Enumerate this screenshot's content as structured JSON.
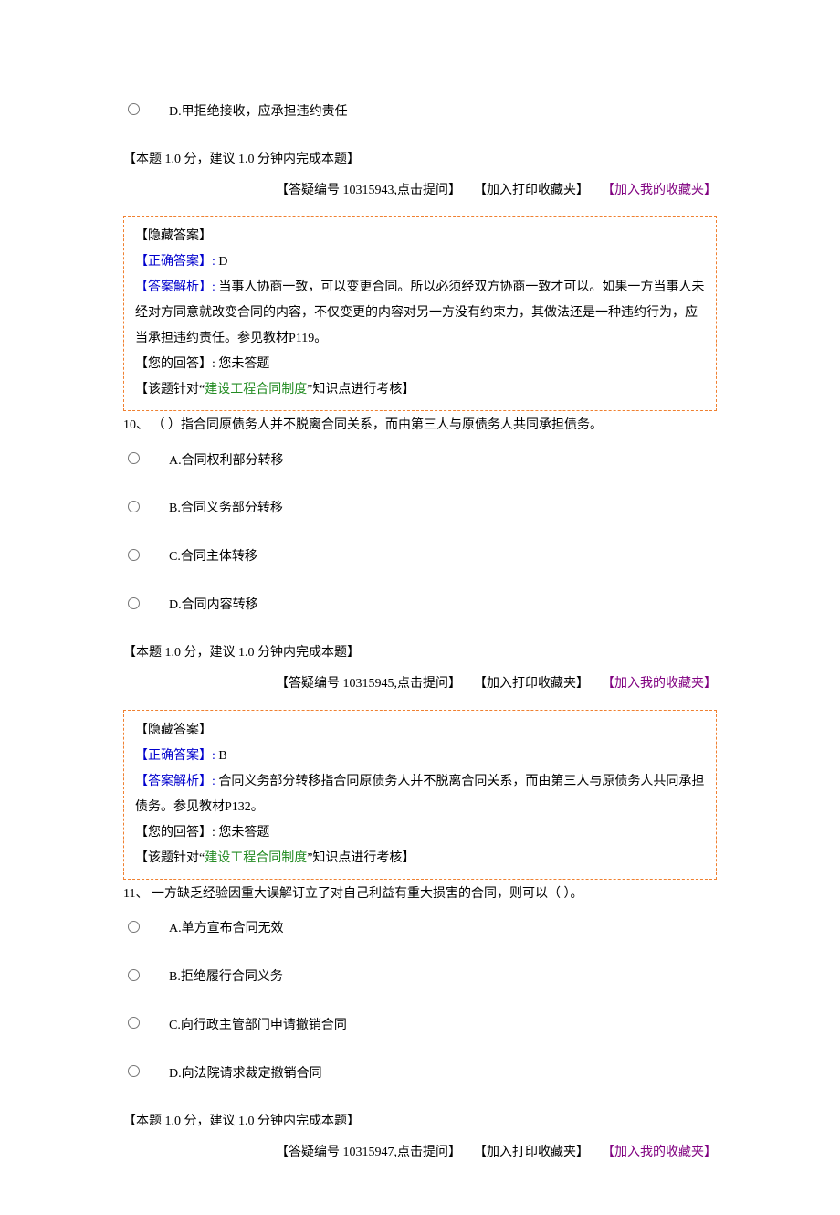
{
  "q9": {
    "option_d": "D.甲拒绝接收，应承担违约责任",
    "score_note": "【本题  1.0  分，建议  1.0  分钟内完成本题】",
    "link_q": "【答疑编号 10315943,点击提问】",
    "link_print": "【加入打印收藏夹】",
    "link_fav": "【加入我的收藏夹】",
    "answer": {
      "hide": "【隐藏答案】",
      "correct_label": "【正确答案】:",
      "correct_value": "  D",
      "analysis_label": "【答案解析】:",
      "analysis_text": "  当事人协商一致，可以变更合同。所以必须经双方协商一致才可以。如果一方当事人未经对方同意就改变合同的内容，不仅变更的内容对另一方没有约束力，其做法还是一种违约行为，应当承担违约责任。参见教材P119。",
      "your_label": "【您的回答】:",
      "your_value": "  您未答题",
      "kp_prefix": "【该题针对“",
      "kp_text": "建设工程合同制度",
      "kp_suffix": "”知识点进行考核】"
    }
  },
  "q10": {
    "stem": "10、  （    ）指合同原债务人并不脱离合同关系，而由第三人与原债务人共同承担债务。",
    "options": {
      "a": "A.合同权利部分转移",
      "b": "B.合同义务部分转移",
      "c": "C.合同主体转移",
      "d": "D.合同内容转移"
    },
    "score_note": "【本题  1.0  分，建议  1.0  分钟内完成本题】",
    "link_q": "【答疑编号 10315945,点击提问】",
    "link_print": "【加入打印收藏夹】",
    "link_fav": "【加入我的收藏夹】",
    "answer": {
      "hide": "【隐藏答案】",
      "correct_label": "【正确答案】:",
      "correct_value": "  B",
      "analysis_label": "【答案解析】:",
      "analysis_text": "  合同义务部分转移指合同原债务人并不脱离合同关系，而由第三人与原债务人共同承担债务。参见教材P132。",
      "your_label": "【您的回答】:",
      "your_value": "  您未答题",
      "kp_prefix": "【该题针对“",
      "kp_text": "建设工程合同制度",
      "kp_suffix": "”知识点进行考核】"
    }
  },
  "q11": {
    "stem": "11、  一方缺乏经验因重大误解订立了对自己利益有重大损害的合同，则可以（    ）。",
    "options": {
      "a": "A.单方宣布合同无效",
      "b": "B.拒绝履行合同义务",
      "c": "C.向行政主管部门申请撤销合同",
      "d": "D.向法院请求裁定撤销合同"
    },
    "score_note": "【本题  1.0  分，建议  1.0  分钟内完成本题】",
    "link_q": "【答疑编号 10315947,点击提问】",
    "link_print": "【加入打印收藏夹】",
    "link_fav": "【加入我的收藏夹】"
  }
}
